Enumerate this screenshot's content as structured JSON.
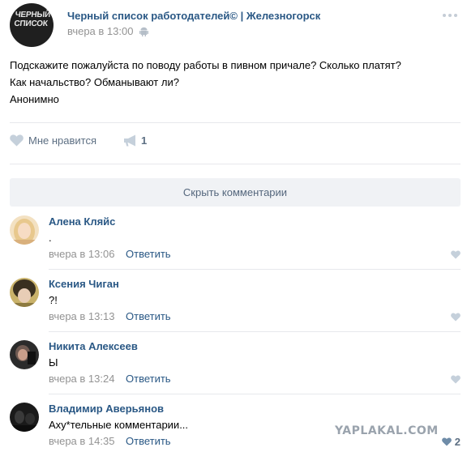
{
  "post": {
    "group_avatar_text": "ЧЕРНЫЙ СПИСОК",
    "group_name": "Черный список работодателей© | Железногорск",
    "time": "вчера в 13:00",
    "text_lines": [
      "Подскажите пожалуйста по поводу работы в пивном причале? Сколько платят?",
      "Как начальство? Обманывают ли?",
      "Анонимно"
    ],
    "like_label": "Мне нравится",
    "share_count": "1",
    "hide_comments_label": "Скрыть комментарии"
  },
  "comments": [
    {
      "author": "Алена Кляйс",
      "text": ".",
      "time": "вчера в 13:06",
      "reply": "Ответить",
      "likes": ""
    },
    {
      "author": "Ксения Чиган",
      "text": "?!",
      "time": "вчера в 13:13",
      "reply": "Ответить",
      "likes": ""
    },
    {
      "author": "Никита Алексеев",
      "text": "Ы",
      "time": "вчера в 13:24",
      "reply": "Ответить",
      "likes": ""
    },
    {
      "author": "Владимир Аверьянов",
      "text": "Аху*тельные комментарии...",
      "time": "вчера в 14:35",
      "reply": "Ответить",
      "likes": "2"
    }
  ],
  "watermark": "YAPLAKAL.COM",
  "colors": {
    "link": "#2a5885",
    "meta": "#939393",
    "action": "#5d6f83",
    "divider": "#e7e8ec",
    "button_bg": "#f0f2f5",
    "heart_inactive": "#c5d0db",
    "heart_active": "#6f8ca8"
  },
  "icons": {
    "more": "more-dots-icon",
    "platform": "android-icon",
    "like": "heart-icon",
    "share": "megaphone-icon"
  }
}
